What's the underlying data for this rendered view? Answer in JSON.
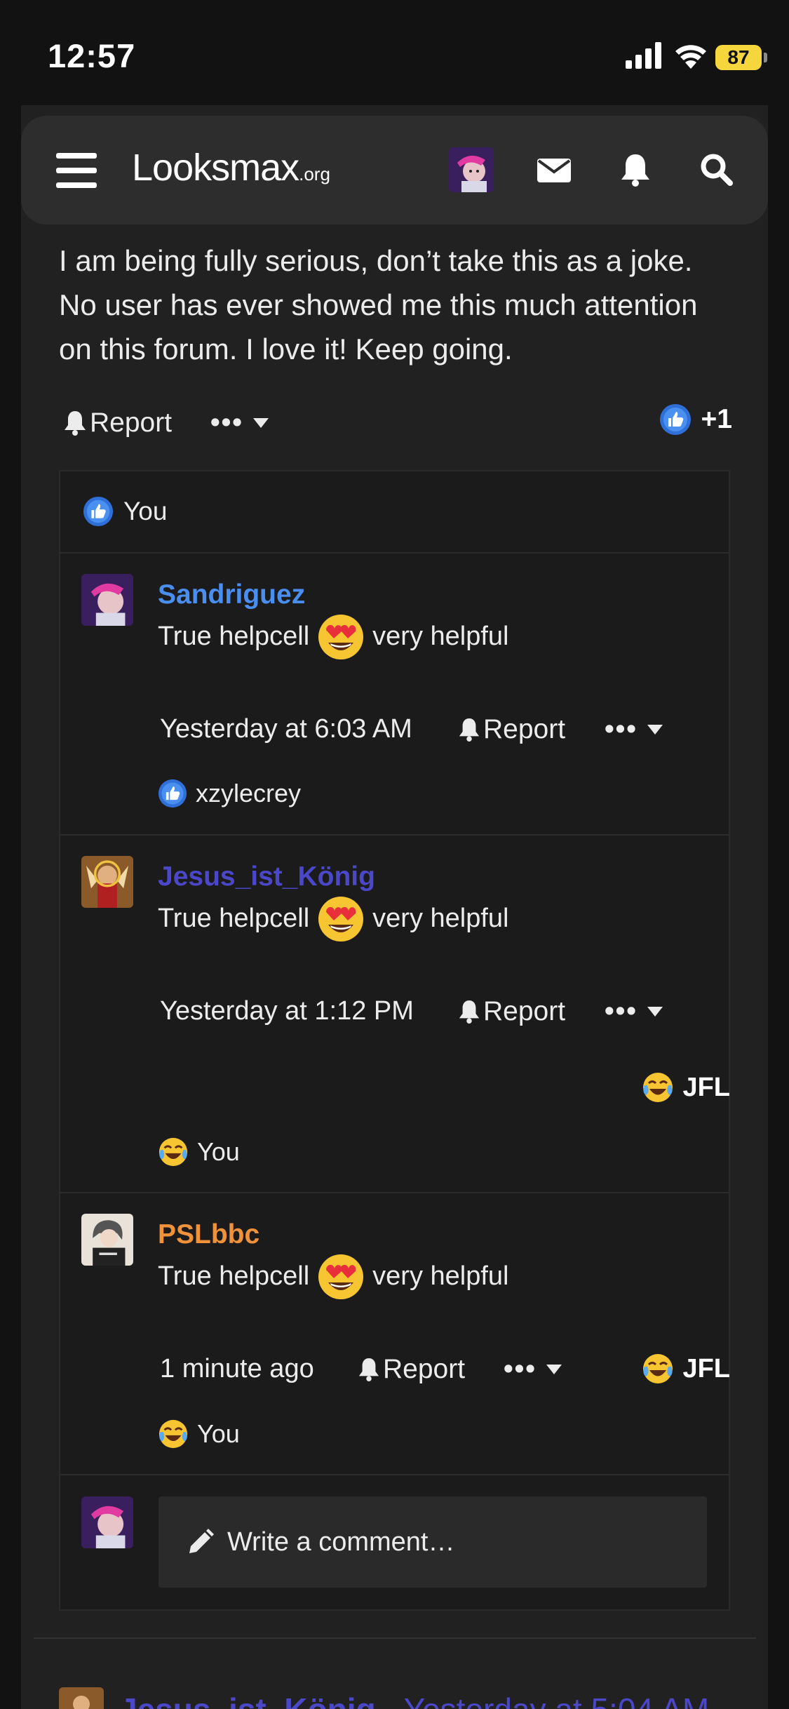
{
  "status_bar": {
    "time": "12:57",
    "battery": "87"
  },
  "header": {
    "logo_main": "Looksmax",
    "logo_suffix": ".org"
  },
  "post": {
    "text": "I am being fully serious, don’t take this as a joke. No user has ever showed me this much attention on this forum. I love it! Keep going.",
    "report_label": "Report",
    "more_label": "•••",
    "like_count": "+1",
    "likers": "You"
  },
  "comments": [
    {
      "author": "Sandriguez",
      "author_color": "#4a8ef0",
      "text_before": "True helpcell",
      "text_after": "very helpful",
      "timestamp": "Yesterday at 6:03 AM",
      "report_label": "Report",
      "more_label": "•••",
      "reactor": "xzylecrey",
      "reactor_icon": "like-icon"
    },
    {
      "author": "Jesus_ist_König",
      "author_color": "#4a47c8",
      "text_before": "True helpcell",
      "text_after": "very helpful",
      "timestamp": "Yesterday at 1:12 PM",
      "report_label": "Report",
      "more_label": "•••",
      "reaction_label": "JFL",
      "reactor": "You",
      "reactor_icon": "crying-laughing-icon"
    },
    {
      "author": "PSLbbc",
      "author_color": "#f0923a",
      "text_before": "True helpcell",
      "text_after": "very helpful",
      "timestamp": "1 minute ago",
      "report_label": "Report",
      "more_label": "•••",
      "reaction_label": "JFL",
      "reactor": "You",
      "reactor_icon": "crying-laughing-icon"
    }
  ],
  "write_comment": {
    "placeholder": "Write a comment…"
  },
  "next_post": {
    "author": "Jesus_ist_König",
    "separator": "·",
    "timestamp": "Yesterday at 5:04 AM"
  },
  "colors": {
    "accent_blue": "#4a8ef0",
    "background": "#212121",
    "header": "#2d2d2d"
  }
}
